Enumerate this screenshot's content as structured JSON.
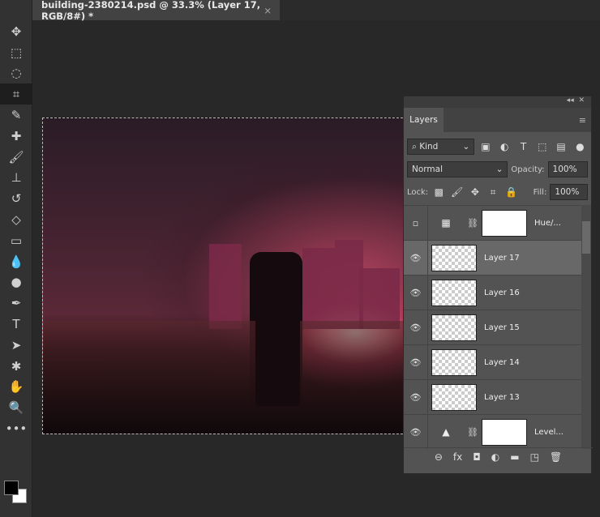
{
  "document_tab": {
    "title": "building-2380214.psd @ 33.3% (Layer 17, RGB/8#) *",
    "close": "×"
  },
  "tools": [
    {
      "name": "move",
      "glyph": "✥"
    },
    {
      "name": "marquee",
      "glyph": "⬚"
    },
    {
      "name": "lasso",
      "glyph": "◌"
    },
    {
      "name": "crop",
      "glyph": "⌗"
    },
    {
      "name": "eyedropper",
      "glyph": "✎"
    },
    {
      "name": "healing",
      "glyph": "✚"
    },
    {
      "name": "brush",
      "glyph": "🖌"
    },
    {
      "name": "stamp",
      "glyph": "⊥"
    },
    {
      "name": "history-brush",
      "glyph": "↺"
    },
    {
      "name": "eraser",
      "glyph": "◇"
    },
    {
      "name": "gradient",
      "glyph": "▭"
    },
    {
      "name": "blur",
      "glyph": "💧"
    },
    {
      "name": "dodge",
      "glyph": "●"
    },
    {
      "name": "pen",
      "glyph": "✒"
    },
    {
      "name": "type",
      "glyph": "T"
    },
    {
      "name": "path-select",
      "glyph": "➤"
    },
    {
      "name": "shape",
      "glyph": "✱"
    },
    {
      "name": "hand",
      "glyph": "✋"
    },
    {
      "name": "zoom",
      "glyph": "🔍"
    },
    {
      "name": "more",
      "glyph": "•••"
    }
  ],
  "panel": {
    "collapse": "◂◂",
    "close": "✕",
    "tab": "Layers",
    "menu": "≡",
    "filter": {
      "label": "Kind",
      "icon": "search-icon"
    },
    "blend_mode": "Normal",
    "opacity_label": "Opacity:",
    "opacity": "100%",
    "lock_label": "Lock:",
    "fill_label": "Fill:",
    "fill": "100%",
    "layers": [
      {
        "name": "Hue/...",
        "type": "adjustment",
        "visible": false,
        "adj_glyph": "▦"
      },
      {
        "name": "Layer 17",
        "type": "pixel",
        "visible": true,
        "active": true
      },
      {
        "name": "Layer 16",
        "type": "pixel",
        "visible": true
      },
      {
        "name": "Layer 15",
        "type": "pixel",
        "visible": true
      },
      {
        "name": "Layer 14",
        "type": "pixel",
        "visible": true
      },
      {
        "name": "Layer 13",
        "type": "pixel",
        "visible": true
      },
      {
        "name": "Level...",
        "type": "adjustment",
        "visible": true,
        "adj_glyph": "▲"
      }
    ],
    "footer": [
      "⊖",
      "fx",
      "◘",
      "◐",
      "▬",
      "◳",
      "🗑"
    ]
  }
}
